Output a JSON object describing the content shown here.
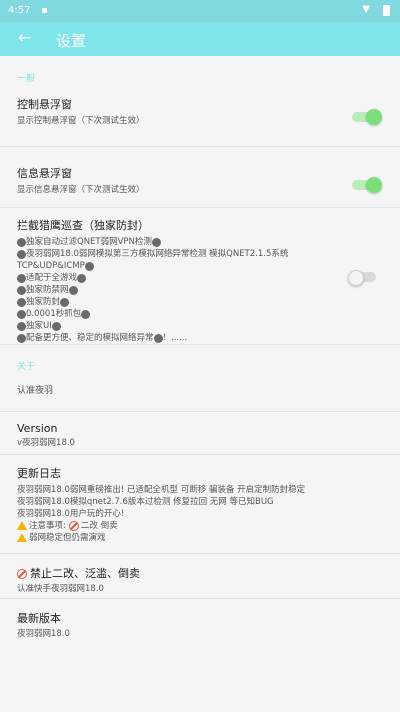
{
  "status_bar": {
    "time": "4:57"
  },
  "toolbar": {
    "back_icon": "arrow-left-icon",
    "title": "设置"
  },
  "sections": {
    "general_header": "一般",
    "about_header": "关于"
  },
  "items": {
    "control_float": {
      "title": "控制悬浮窗",
      "summary": "显示控制悬浮窗（下次测试生效）",
      "switch_on": true
    },
    "info_float": {
      "title": "信息悬浮窗",
      "summary": "显示信息悬浮窗（下次测试生效）",
      "switch_on": true
    },
    "intercept": {
      "title": "拦截猎鹰巡查（独家防封）",
      "lines": [
        "独家自动过滤QNET弱网VPN检测",
        "夜羽弱网18.0弱网模拟第三方模拟网络异常检测 模拟QNET2.1.5系统",
        "TCP&UDP&ICMP",
        "适配于全游戏",
        "独家防禁网",
        "独家防封",
        "0.0001秒抓包",
        "独家UI",
        "配备更方便、稳定的模拟网络异常",
        "！......"
      ],
      "switch_on": false
    },
    "author": {
      "title": "认准夜羽"
    },
    "version": {
      "title": "Version",
      "summary": "v夜羽弱网18.0"
    },
    "changelog": {
      "title": "更新日志",
      "lines": [
        "夜羽弱网18.0弱网重磅推出! 已适配全机型 可断移 骗装备 开启定制防封稳定",
        "夜羽弱网18.0模拟qnet2.7.6版本过检测 修复拉回 无网 等已知BUG",
        "夜羽弱网18.0用户玩的开心!",
        "注意事项:",
        "二改 倒卖",
        "弱网稳定但仍需演戏"
      ]
    },
    "no_resale": {
      "title": "禁止二改、泛滥、倒卖",
      "summary": "认准快手夜羽弱网18.0"
    },
    "latest": {
      "title": "最新版本",
      "summary": "夜羽弱网18.0"
    }
  }
}
